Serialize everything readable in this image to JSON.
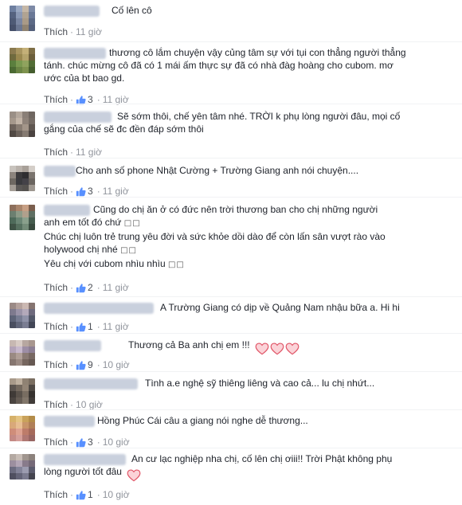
{
  "ui": {
    "like_label": "Thích",
    "separator": "·",
    "box_glyph": "□□",
    "heart_color": "#f06b7d",
    "heart_stroke": "#e05466",
    "thumb_color": "#5890ff"
  },
  "comments": [
    {
      "name_visible": "Cố lên cô",
      "lines": [],
      "likes": null,
      "time": "11 giờ",
      "avatar": [
        "#6e7fa0",
        "#9aa8c2",
        "#c5b7a6",
        "#7d8aa6",
        "#55627f",
        "#8b99b5",
        "#b0a392",
        "#6a7896",
        "#4e5a75",
        "#7a86a2",
        "#a99a87",
        "#5c6985",
        "#46506a",
        "#6b7792",
        "#908371",
        "#535f7a"
      ]
    },
    {
      "name_visible": "",
      "lines": [
        "thương cô lắm chuyện vậy củng tâm sự với tụi con thẳng người thẳng",
        "tánh. chúc mừng cô đã có 1 mái ấm thực sự đã có nhà đàg hoàng cho cubom. mơ",
        "ước của bt bao gd."
      ],
      "likes": "3",
      "time": "11 giờ",
      "avatar": [
        "#8a7a4f",
        "#a89560",
        "#c4b078",
        "#7e6e46",
        "#6f6a3e",
        "#99884f",
        "#b4a36b",
        "#6b5e3a",
        "#5b7f3e",
        "#7a9950",
        "#8fa35e",
        "#526c35",
        "#4b6a33",
        "#6a8444",
        "#7e924e",
        "#455d2e"
      ]
    },
    {
      "name_visible": "",
      "lines": [
        "Sẽ sớm thôi, chế yên tâm nhé. TRỜI k phụ lòng người đâu, mọi cố",
        "gắng của chế sẽ đc đền đáp sớm thôi"
      ],
      "likes": null,
      "time": "11 giờ",
      "avatar": [
        "#9a8f86",
        "#b3a79c",
        "#8a7f77",
        "#6f6660",
        "#a5988c",
        "#c2b4a7",
        "#8f837a",
        "#756b64",
        "#6d625b",
        "#887c72",
        "#a39589",
        "#5f5650",
        "#514944",
        "#6c625b",
        "#857a71",
        "#4a4340"
      ]
    },
    {
      "name_visible": "",
      "lines": [
        "Cho anh số phone Nhật Cường + Trường Giang anh nói chuyện...."
      ],
      "likes": "3",
      "time": "11 giờ",
      "avatar": [
        "#c8c3bd",
        "#b9b2ab",
        "#a8a098",
        "#d4cec8",
        "#8c847d",
        "#3b3a3c",
        "#2f2e31",
        "#7a736d",
        "#6e6862",
        "#3a3a3e",
        "#444248",
        "#6a645f",
        "#a39c95",
        "#5b5856",
        "#55524f",
        "#9d968f"
      ]
    },
    {
      "name_visible": "",
      "lines": [
        "Cũng do chị ăn ở có đức nên trời thương ban cho chị những người",
        "anh em tốt đó chứ {box}",
        "Chúc chị luôn trẻ trung yêu đời và sức khỏe dồi dào để còn lấn sân vượt rào vào",
        "holywood chị nhé {box}",
        "Yêu chị với cubom nhìu nhìu {box}"
      ],
      "likes": "2",
      "time": "11 giờ",
      "avatar": [
        "#8d6f5c",
        "#a9856c",
        "#c79f84",
        "#7a5e4d",
        "#6c7f70",
        "#8d9b88",
        "#b0a08c",
        "#5f6f63",
        "#4e6a5a",
        "#6a8574",
        "#8aa08c",
        "#455c4e",
        "#3f5346",
        "#56705f",
        "#748c79",
        "#384a3e"
      ]
    },
    {
      "name_visible": "",
      "lines": [
        "A Trường Giang có dịp về Quảng Nam nhậu bữa a. Hi hi"
      ],
      "likes": "1",
      "time": "11 giờ",
      "avatar": [
        "#9b8a86",
        "#b5a29d",
        "#cbb8b2",
        "#857470",
        "#7e7a8e",
        "#9a93a8",
        "#b3a9ba",
        "#6e6a7d",
        "#5e6478",
        "#777c92",
        "#8f92a8",
        "#535869",
        "#4a4f60",
        "#62677b",
        "#7a7d92",
        "#424656"
      ]
    },
    {
      "name_visible": "",
      "lines": [
        "Thương cả Ba anh chị em !!! {hearts3}"
      ],
      "likes": "9",
      "time": "10 giờ",
      "avatar": [
        "#c7b8b2",
        "#d8cbc5",
        "#b7a7a0",
        "#a8978f",
        "#b3a3b8",
        "#c7b8cc",
        "#9d8ea5",
        "#8d7f94",
        "#9a8a82",
        "#b09f97",
        "#8a7a73",
        "#776862",
        "#867670",
        "#9b8a83",
        "#76665f",
        "#665852"
      ]
    },
    {
      "name_visible": "",
      "lines": [
        "Tình a.e nghệ sỹ thiêng liêng và cao cả... lu chị nhứt..."
      ],
      "likes": null,
      "time": "10 giờ",
      "avatar": [
        "#a89a8a",
        "#bfb1a0",
        "#8f8273",
        "#7a6e61",
        "#5c5550",
        "#74695e",
        "#938576",
        "#4f4944",
        "#3f3a37",
        "#5a524b",
        "#786d61",
        "#36322f",
        "#4a4440",
        "#655c54",
        "#81766a",
        "#403b38"
      ]
    },
    {
      "name_visible": "Hồng Phúc",
      "lines": [
        "Cái câu a giang nói nghe dễ thương..."
      ],
      "likes": "3",
      "time": "10 giờ",
      "avatar": [
        "#d6b16a",
        "#e4c382",
        "#c9a25b",
        "#b38c49",
        "#d9a87a",
        "#e7bd92",
        "#c8956a",
        "#b07f58",
        "#cf8d7a",
        "#dea291",
        "#bd7c6a",
        "#a56a5b",
        "#c48a85",
        "#d49e99",
        "#b07873",
        "#986562"
      ]
    },
    {
      "name_visible": "",
      "lines": [
        "An cư lạc nghiệp nha chị, cố lên chị ơiii!! Trời Phật không phụ",
        "lòng người tốt đâu {hearts1}"
      ],
      "likes": "1",
      "time": "10 giờ",
      "avatar": [
        "#b4a9a2",
        "#c8bdb6",
        "#a0958e",
        "#8c827c",
        "#9c8f9f",
        "#b2a5b5",
        "#887b8b",
        "#756a78",
        "#6c6c80",
        "#838399",
        "#9c9cb0",
        "#5b5b6d",
        "#4f4f60",
        "#646478",
        "#7b7b8f",
        "#44444f"
      ]
    }
  ]
}
